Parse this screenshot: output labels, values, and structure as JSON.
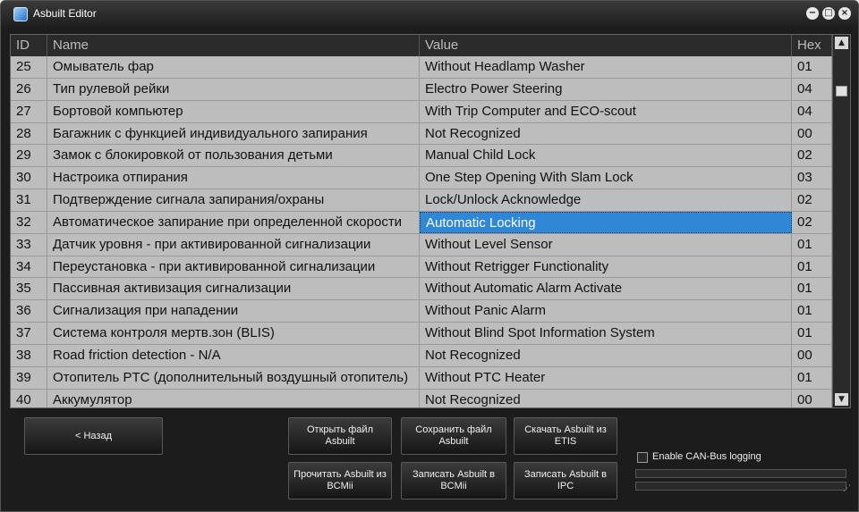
{
  "window": {
    "title": "Asbuilt Editor"
  },
  "table": {
    "headers": {
      "id": "ID",
      "name": "Name",
      "value": "Value",
      "hex": "Hex"
    },
    "selected_row": 7,
    "rows": [
      {
        "id": "25",
        "name": "Омыватель фар",
        "value": "Without Headlamp Washer",
        "hex": "01"
      },
      {
        "id": "26",
        "name": "Тип рулевой рейки",
        "value": "Electro Power Steering",
        "hex": "04"
      },
      {
        "id": "27",
        "name": "Бортовой компьютер",
        "value": "With Trip Computer and ECO-scout",
        "hex": "04"
      },
      {
        "id": "28",
        "name": "Багажник с функцией индивидуального запирания",
        "value": "Not Recognized",
        "hex": "00"
      },
      {
        "id": "29",
        "name": "Замок с блокировкой от пользования детьми",
        "value": "Manual Child Lock",
        "hex": "02"
      },
      {
        "id": "30",
        "name": "Настроика отпирания",
        "value": "One Step Opening With Slam Lock",
        "hex": "03"
      },
      {
        "id": "31",
        "name": "Подтверждение сигнала запирания/охраны",
        "value": "Lock/Unlock Acknowledge",
        "hex": "02"
      },
      {
        "id": "32",
        "name": "Автоматическое запирание при определенной скорости",
        "value": "Automatic Locking",
        "hex": "02"
      },
      {
        "id": "33",
        "name": "Датчик уровня - при активированной сигнализации",
        "value": "Without Level Sensor",
        "hex": "01"
      },
      {
        "id": "34",
        "name": "Переустановка - при активированной сигнализации",
        "value": "Without Retrigger Functionality",
        "hex": "01"
      },
      {
        "id": "35",
        "name": "Пассивная активизация сигнализации",
        "value": "Without Automatic Alarm Activate",
        "hex": "01"
      },
      {
        "id": "36",
        "name": "Сигнализация при нападении",
        "value": "Without Panic Alarm",
        "hex": "01"
      },
      {
        "id": "37",
        "name": "Система контроля мертв.зон (BLIS)",
        "value": "Without Blind Spot Information System",
        "hex": "01"
      },
      {
        "id": "38",
        "name": "Road friction detection - N/A",
        "value": "Not Recognized",
        "hex": "00"
      },
      {
        "id": "39",
        "name": "Отопитель PTC (дополнительный воздушный отопитель)",
        "value": "Without PTC Heater",
        "hex": "01"
      },
      {
        "id": "40",
        "name": "Аккумулятор",
        "value": "Not Recognized",
        "hex": "00"
      }
    ]
  },
  "buttons": {
    "back": "< Назад",
    "open_file": "Открыть файл\nAsbuilt",
    "save_file": "Сохранить файл\nAsbuilt",
    "download_etis": "Скачать Asbuilt из\nETIS",
    "read_bcmii": "Прочитать Asbuilt из\nBCMii",
    "write_bcmii": "Записать Asbuilt в\nBCMii",
    "write_ipc": "Записать Asbuilt в\nIPC"
  },
  "can_logging": {
    "label": "Enable CAN-Bus logging",
    "checked": false
  },
  "colors": {
    "selection": "#2f87d6",
    "grid_bg": "#bdbdbd",
    "window_bg": "#1c1c1c"
  }
}
